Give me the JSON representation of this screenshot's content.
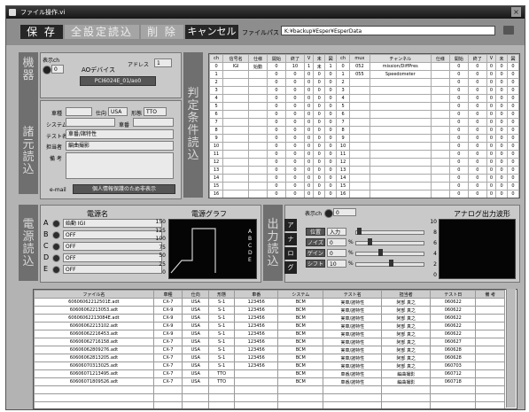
{
  "window": {
    "title": "ファイル操作.vi",
    "close_label": "×"
  },
  "toolbar": {
    "save": "保 存",
    "load_all": "全設定読込",
    "delete": "削 除",
    "cancel": "キャンセル",
    "file_path_label": "ファイルパス",
    "file_path": "K:¥backup¥Esper¥EsperData"
  },
  "device": {
    "side_label": "機器",
    "display_label": "表示ch",
    "display_value": "0",
    "ao_label": "AOデバイス",
    "addr_label": "アドレス",
    "addr_value": "1",
    "device_value": "PCI6024E_01/ao0"
  },
  "specs": {
    "side_label": "諸元読込",
    "vehicle_label": "車種",
    "vehicle_value": "",
    "spec_label": "仕向",
    "spec_value": "USA",
    "model_label": "形態",
    "model_value": "TTO",
    "system_label": "システム",
    "car_no_label": "車番",
    "test_name_label": "テスト名",
    "test_name_value": "車番/諸特性",
    "person_label": "担当者",
    "person_value": "編曲撮影",
    "note_label": "備 考",
    "email_label": "e-mail",
    "privacy_button": "個人情報保護のため非表示"
  },
  "judge": {
    "side_label": "判定条件読込",
    "headers": [
      "ch",
      "信号名",
      "仕様",
      "開始",
      "終了",
      "V",
      "未",
      "図",
      "ch",
      "mux",
      "チャンネル",
      "仕様",
      "開始",
      "終了",
      "V",
      "未",
      "図"
    ],
    "rows": [
      [
        "0",
        "IGI",
        "始動",
        "0",
        "10",
        "1",
        "未",
        "1",
        "0",
        "052",
        "mission/DiffPres",
        "",
        "0",
        "0",
        "0",
        "0",
        "0"
      ],
      [
        "1",
        "",
        "",
        "0",
        "0",
        "0",
        "0",
        "0",
        "1",
        "055",
        "Speedometer",
        "",
        "0",
        "0",
        "0",
        "0",
        "0"
      ],
      [
        "2",
        "",
        "",
        "0",
        "0",
        "0",
        "0",
        "0",
        "2",
        "",
        "",
        "",
        "0",
        "0",
        "0",
        "0",
        "0"
      ],
      [
        "3",
        "",
        "",
        "0",
        "0",
        "0",
        "0",
        "0",
        "3",
        "",
        "",
        "",
        "0",
        "0",
        "0",
        "0",
        "0"
      ],
      [
        "4",
        "",
        "",
        "0",
        "0",
        "0",
        "0",
        "0",
        "4",
        "",
        "",
        "",
        "0",
        "0",
        "0",
        "0",
        "0"
      ],
      [
        "5",
        "",
        "",
        "0",
        "0",
        "0",
        "0",
        "0",
        "5",
        "",
        "",
        "",
        "0",
        "0",
        "0",
        "0",
        "0"
      ],
      [
        "6",
        "",
        "",
        "0",
        "0",
        "0",
        "0",
        "0",
        "6",
        "",
        "",
        "",
        "0",
        "0",
        "0",
        "0",
        "0"
      ],
      [
        "7",
        "",
        "",
        "0",
        "0",
        "0",
        "0",
        "0",
        "7",
        "",
        "",
        "",
        "0",
        "0",
        "0",
        "0",
        "0"
      ],
      [
        "8",
        "",
        "",
        "0",
        "0",
        "0",
        "0",
        "0",
        "8",
        "",
        "",
        "",
        "0",
        "0",
        "0",
        "0",
        "0"
      ],
      [
        "9",
        "",
        "",
        "0",
        "0",
        "0",
        "0",
        "0",
        "9",
        "",
        "",
        "",
        "0",
        "0",
        "0",
        "0",
        "0"
      ],
      [
        "10",
        "",
        "",
        "0",
        "0",
        "0",
        "0",
        "0",
        "10",
        "",
        "",
        "",
        "0",
        "0",
        "0",
        "0",
        "0"
      ],
      [
        "11",
        "",
        "",
        "0",
        "0",
        "0",
        "0",
        "0",
        "11",
        "",
        "",
        "",
        "0",
        "0",
        "0",
        "0",
        "0"
      ],
      [
        "12",
        "",
        "",
        "0",
        "0",
        "0",
        "0",
        "0",
        "12",
        "",
        "",
        "",
        "0",
        "0",
        "0",
        "0",
        "0"
      ],
      [
        "13",
        "",
        "",
        "0",
        "0",
        "0",
        "0",
        "0",
        "13",
        "",
        "",
        "",
        "0",
        "0",
        "0",
        "0",
        "0"
      ],
      [
        "14",
        "",
        "",
        "0",
        "0",
        "0",
        "0",
        "0",
        "14",
        "",
        "",
        "",
        "0",
        "0",
        "0",
        "0",
        "0"
      ],
      [
        "15",
        "",
        "",
        "0",
        "0",
        "0",
        "0",
        "0",
        "15",
        "",
        "",
        "",
        "0",
        "0",
        "0",
        "0",
        "0"
      ],
      [
        "16",
        "",
        "",
        "0",
        "0",
        "0",
        "0",
        "0",
        "16",
        "",
        "",
        "",
        "0",
        "0",
        "0",
        "0",
        "0"
      ]
    ]
  },
  "power": {
    "side_label": "電源読込",
    "name_header": "電源名",
    "graph_title": "電源グラフ",
    "sources": [
      {
        "letter": "A",
        "name": "始動 IGI"
      },
      {
        "letter": "B",
        "name": "OFF"
      },
      {
        "letter": "C",
        "name": "OFF"
      },
      {
        "letter": "D",
        "name": "OFF"
      },
      {
        "letter": "E",
        "name": "OFF"
      }
    ],
    "y_ticks": [
      "150",
      "125",
      "100",
      "75",
      "50",
      "25",
      "0"
    ],
    "legend": [
      "A",
      "B",
      "C",
      "D",
      "E"
    ]
  },
  "output": {
    "side_label": "出力読込",
    "display_label": "表示ch",
    "display_value": "0",
    "vertical_labels": [
      "ア",
      "ナ",
      "ロ",
      "グ"
    ],
    "controls": [
      {
        "label": "位置",
        "value": "入力"
      },
      {
        "label": "ノイズ",
        "value": "0",
        "unit": "%"
      },
      {
        "label": "ゲイン",
        "value": "0",
        "unit": "%"
      },
      {
        "label": "シフト",
        "value": "10",
        "unit": "%"
      }
    ],
    "analog_title": "アナログ出力波形",
    "analog_ticks": [
      "10",
      "8",
      "6",
      "4",
      "2",
      "0"
    ]
  },
  "file_table": {
    "headers": [
      "ファイル名",
      "車種",
      "仕向",
      "形態",
      "車番",
      "システム",
      "テスト名",
      "担当者",
      "テスト日",
      "備 考"
    ],
    "rows": [
      [
        "60606062212501E.adt",
        "CX-7",
        "USA",
        "S-1",
        "123456",
        "BCM",
        "実車/諸特性",
        "阿部 真之",
        "060622",
        ""
      ],
      [
        "60606062213053.adt",
        "CX-9",
        "USA",
        "S-1",
        "123456",
        "BCM",
        "実車/諸特性",
        "阿部 真之",
        "060622",
        ""
      ],
      [
        "60606062213084E.adt",
        "CX-9",
        "USA",
        "S-1",
        "123456",
        "BCM",
        "実車/諸特性",
        "阿部 真之",
        "060622",
        ""
      ],
      [
        "60606062213102.adt",
        "CX-9",
        "USA",
        "S-1",
        "123456",
        "BCM",
        "実車/諸特性",
        "阿部 真之",
        "060622",
        ""
      ],
      [
        "60606062216453.adt",
        "CX-9",
        "USA",
        "S-1",
        "123456",
        "BCM",
        "実車/諸特性",
        "阿部 真之",
        "060622",
        ""
      ],
      [
        "60606062716158.adt",
        "CX-7",
        "USA",
        "S-1",
        "123456",
        "BCM",
        "実車/諸特性",
        "阿部 真之",
        "060627",
        ""
      ],
      [
        "60606062809276.adt",
        "CX-7",
        "USA",
        "S-1",
        "123456",
        "BCM",
        "実車/諸特性",
        "阿部 真之",
        "060628",
        ""
      ],
      [
        "60606062813205.adt",
        "CX-7",
        "USA",
        "S-1",
        "123456",
        "BCM",
        "実車/諸特性",
        "阿部 真之",
        "060628",
        ""
      ],
      [
        "60606070313025.adt",
        "CX-7",
        "USA",
        "S-1",
        "123456",
        "BCM",
        "実車/諸特性",
        "阿部 真之",
        "060703",
        ""
      ],
      [
        "60606071213495.adt",
        "CX-7",
        "USA",
        "TTO",
        "",
        "BCM",
        "車番/諸特性",
        "編曲撮影",
        "060712",
        ""
      ],
      [
        "60606071809526.adt",
        "CX-7",
        "USA",
        "TTO",
        "",
        "BCM",
        "車番/諸特性",
        "編曲撮影",
        "060718",
        ""
      ]
    ]
  }
}
